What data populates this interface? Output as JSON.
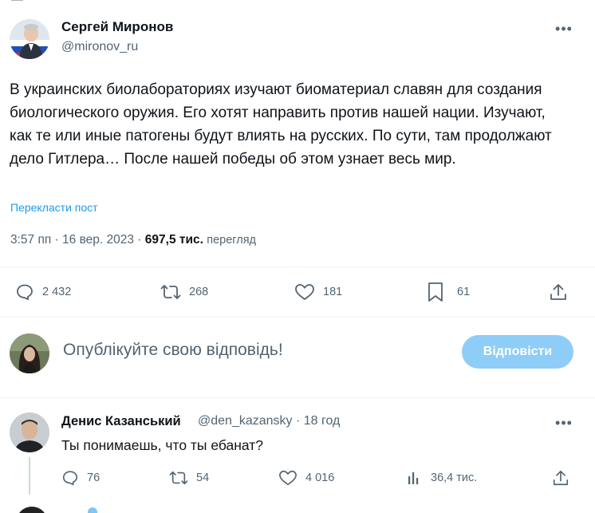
{
  "colors": {
    "accent": "#1d9bf0",
    "muted": "#536471",
    "text": "#0f1419",
    "reply_button": "#8ecdf7",
    "divider": "#eff3f4"
  },
  "tweet": {
    "author_name": "Сергей Миронов",
    "author_handle": "@mironov_ru",
    "more_icon": "more-horizontal-icon",
    "text": "В украинских биолабораториях изучают биоматериал славян для создания биологического оружия. Его хотят направить против нашей нации. Изучают, как те или иные патогены будут влиять на русских. По сути, там продолжают дело Гитлера… После нашей победы об этом узнает весь мир.",
    "translate_label": "Перекласти пост",
    "time": "3:57 пп",
    "separator": " · ",
    "date": "16 вер. 2023",
    "views_count": "697,5 тис.",
    "views_label": "перегляд",
    "actions": {
      "replies": "2 432",
      "reposts": "268",
      "likes": "181",
      "bookmarks": "61"
    }
  },
  "reply_box": {
    "placeholder": "Опублікуйте свою відповідь!",
    "button_label": "Відповісти"
  },
  "comment": {
    "author_name": "Денис Казанський",
    "author_handle": "@den_kazansky",
    "separator": " · ",
    "time_ago": "18 год",
    "text": "Ты понимаешь, что ты ебанат?",
    "actions": {
      "replies": "76",
      "reposts": "54",
      "likes": "4 016",
      "views": "36,4 тис."
    }
  }
}
